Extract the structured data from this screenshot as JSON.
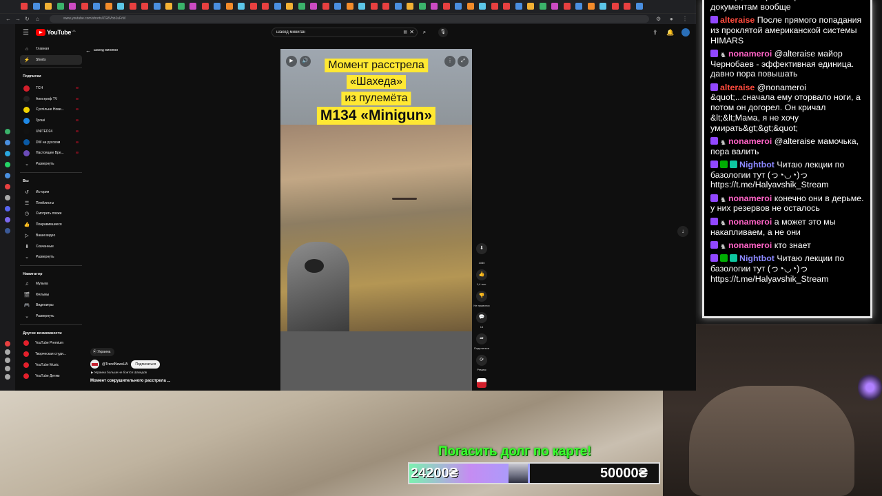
{
  "browser": {
    "url": "www.youtube.com/shorts/ZG8Vbb1uFrM"
  },
  "youtube": {
    "logo_text": "YouTube",
    "logo_region": "UA",
    "search": {
      "value": "шахед миниган"
    },
    "sidebar": {
      "main": [
        {
          "label": "Главная",
          "icon": "home-icon"
        },
        {
          "label": "Shorts",
          "icon": "shorts-icon",
          "active": true
        }
      ],
      "subscriptions_title": "Подписки",
      "subscriptions": [
        {
          "label": "ТСН",
          "color": "#d21f2b"
        },
        {
          "label": "Апостроф TV",
          "color": "#222222"
        },
        {
          "label": "Суспільне Нови...",
          "color": "#f0d200"
        },
        {
          "label": "Гроші",
          "color": "#1e88e5"
        },
        {
          "label": "UNITED24",
          "color": "#111111"
        },
        {
          "label": "DW на русском",
          "color": "#0a5aa5"
        },
        {
          "label": "Настоящее Вре...",
          "color": "#6b4bb8"
        }
      ],
      "expand_label": "Развернуть",
      "you_title": "Вы",
      "you_items": [
        {
          "label": "История",
          "icon": "history-icon"
        },
        {
          "label": "Плейлисты",
          "icon": "playlists-icon"
        },
        {
          "label": "Смотреть позже",
          "icon": "watch-later-icon"
        },
        {
          "label": "Понравившиеся",
          "icon": "like-icon"
        },
        {
          "label": "Ваши видео",
          "icon": "your-videos-icon"
        },
        {
          "label": "Скачанные",
          "icon": "download-icon"
        }
      ],
      "navigator_title": "Навигатор",
      "navigator_items": [
        {
          "label": "Музыка",
          "icon": "music-icon"
        },
        {
          "label": "Фильмы",
          "icon": "movies-icon"
        },
        {
          "label": "Видеоигры",
          "icon": "gaming-icon"
        }
      ],
      "more_title": "Другие возможности",
      "more_items": [
        {
          "label": "YouTube Premium"
        },
        {
          "label": "Творческая студи..."
        },
        {
          "label": "YouTube Music"
        },
        {
          "label": "YouTube Детям"
        }
      ]
    },
    "back_title": "шахед миниган",
    "short": {
      "caption": [
        "Момент расстрела",
        "«Шахеда»",
        "из пулемёта",
        "M134 «Minigun»"
      ]
    },
    "actions": {
      "rating": "1080",
      "likes": "1,4 тыс.",
      "dislike_label": "Не нравится",
      "comments": "14",
      "share_label": "Поделиться",
      "remix_label": "Ремикс"
    },
    "meta": {
      "location": "Украина",
      "channel": "@TrendNewsUA",
      "subscribe_label": "Подписаться",
      "description": "Украина больше не боится Шахедов",
      "title": "Момент сокрушительного расстрела ..."
    }
  },
  "chat": [
    {
      "user": "",
      "text": "вообще, номера не привязаны к документам вообще",
      "color": "#ffffff",
      "badges": []
    },
    {
      "user": "alteraise",
      "text": "После прямого попадания из проклятой американской системы HIMARS",
      "color": "#ff4a3d",
      "badges": [
        "prime"
      ]
    },
    {
      "user": "nonameroi",
      "text": "@alteraise майор Чернобаев - эффективная единица. давно пора повышать",
      "color": "#ff63c6",
      "badges": [
        "prime",
        "horns"
      ]
    },
    {
      "user": "alteraise",
      "text": "@nonameroi &quot;...сначала ему оторвало ноги, а потом он догорел. Он кричал &lt;&lt;Мама, я не хочу умирать&gt;&gt;&quot;",
      "color": "#ff4a3d",
      "badges": [
        "prime"
      ]
    },
    {
      "user": "nonameroi",
      "text": "@alteraise мамочька, пора валить",
      "color": "#ff63c6",
      "badges": [
        "prime",
        "horns"
      ]
    },
    {
      "user": "Nightbot",
      "text": "Читаю лекции по базологии тут (っ◔◡◔)っ https://t.me/Halyavshik_Stream",
      "color": "#8b88ff",
      "badges": [
        "prime",
        "check",
        "bot"
      ]
    },
    {
      "user": "nonameroi",
      "text": "конечно они в дерьме. у них резервов не осталось",
      "color": "#ff63c6",
      "badges": [
        "prime",
        "horns"
      ]
    },
    {
      "user": "nonameroi",
      "text": "а может это мы накапливаем, а не они",
      "color": "#ff63c6",
      "badges": [
        "prime",
        "horns"
      ]
    },
    {
      "user": "nonameroi",
      "text": "кто знает",
      "color": "#ff63c6",
      "badges": [
        "prime",
        "horns"
      ]
    },
    {
      "user": "Nightbot",
      "text": "Читаю лекции по базологии тут (っ◔◡◔)っ https://t.me/Halyavshik_Stream",
      "color": "#8b88ff",
      "badges": [
        "prime",
        "check",
        "bot"
      ]
    }
  ],
  "goal": {
    "title": "Погасить долг по карте!",
    "current": "24200₴",
    "target": "50000₴",
    "progress": 0.484
  }
}
